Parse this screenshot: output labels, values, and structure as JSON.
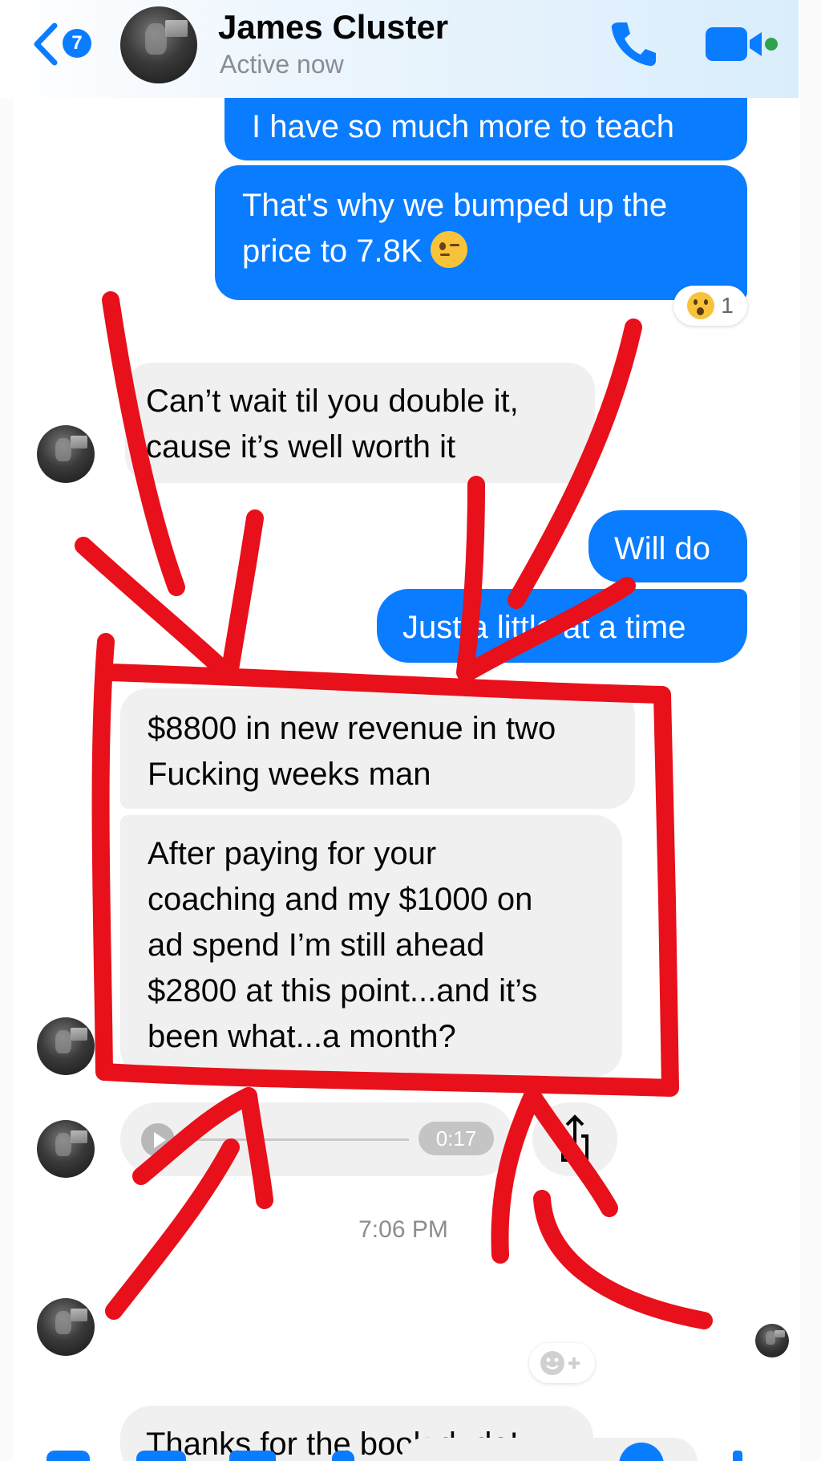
{
  "header": {
    "unread_count": "7",
    "contact_name": "James Cluster",
    "contact_status": "Active now"
  },
  "messages": [
    {
      "direction": "outgoing",
      "text": "I have so much more to teach"
    },
    {
      "direction": "outgoing",
      "text": "That's why we bumped up the\nprice to 7.8K",
      "emoji": "wink-emoji",
      "reaction": {
        "emoji": "surprised-emoji",
        "count": "1"
      }
    },
    {
      "direction": "incoming",
      "text": "Can’t wait til you double it,\ncause it’s well worth it"
    },
    {
      "direction": "outgoing",
      "text": "Will do"
    },
    {
      "direction": "outgoing",
      "text": "Just a little at a time"
    },
    {
      "direction": "incoming",
      "text": "$8800 in new revenue in two\nFucking weeks man"
    },
    {
      "direction": "incoming",
      "text": "After paying for your\ncoaching and my $1000 on\nad spend I’m still ahead\n$2800 at this point...and it’s\nbeen what...a month?"
    }
  ],
  "voice_message": {
    "duration": "0:17"
  },
  "timestamp": "7:06 PM",
  "last_message": {
    "direction": "incoming",
    "text": "Thanks for the book dude!"
  },
  "colors": {
    "accent": "#0a7cff",
    "incoming_bubble": "#f0f0f0",
    "annotation_red": "#e8101a",
    "active_dot": "#31a24c"
  },
  "icons": [
    "back-chevron-icon",
    "phone-icon",
    "video-camera-icon",
    "play-icon",
    "share-icon",
    "add-reaction-icon"
  ]
}
